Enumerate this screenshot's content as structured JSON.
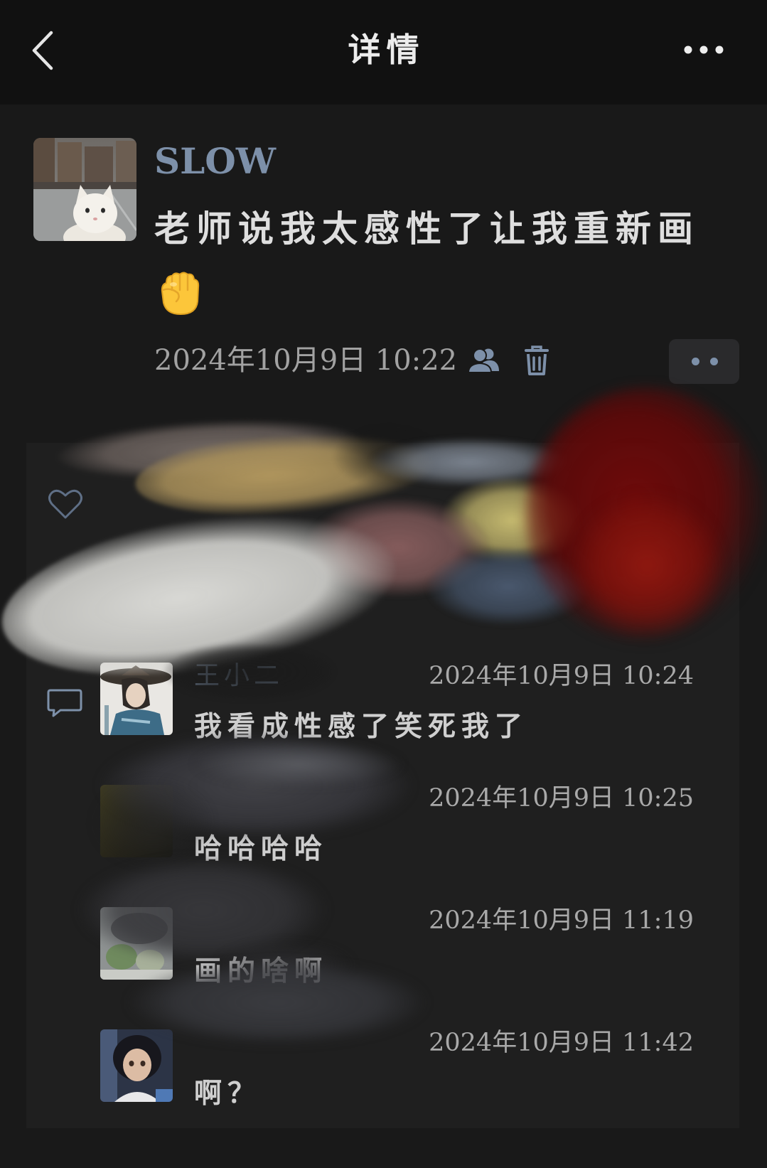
{
  "header": {
    "title": "详情",
    "back_icon": "chevron-left-icon",
    "more_icon": "more-horizontal-icon"
  },
  "post": {
    "avatar": "cat-photo-avatar",
    "author": "SLOW",
    "text": "老师说我太感性了让我重新画",
    "emoji_icon": "raised-fist-emoji",
    "timestamp": "2024年10月9日 10:22",
    "visibility_icon": "friends-icon",
    "delete_icon": "trash-icon",
    "action_icon": "two-dots-icon"
  },
  "interactions": {
    "like_icon": "heart-icon",
    "comment_icon": "comment-bubble-icon",
    "comments": [
      {
        "name": "王小二",
        "time": "2024年10月9日 10:24",
        "text": "我看成性感了笑死我了"
      },
      {
        "name": "",
        "time": "2024年10月9日 10:25",
        "text": "哈哈哈哈"
      },
      {
        "name": "",
        "time": "2024年10月9日 11:19",
        "text": "画的啥啊"
      },
      {
        "name": "",
        "time": "2024年10月9日 11:42",
        "text": "啊？"
      }
    ]
  },
  "colors": {
    "background": "#191919",
    "header_background": "#111111",
    "card_background": "#1f1f1f",
    "link_blue": "#7d90a9",
    "primary_text": "#dedede",
    "secondary_text": "#a2a2a2"
  }
}
